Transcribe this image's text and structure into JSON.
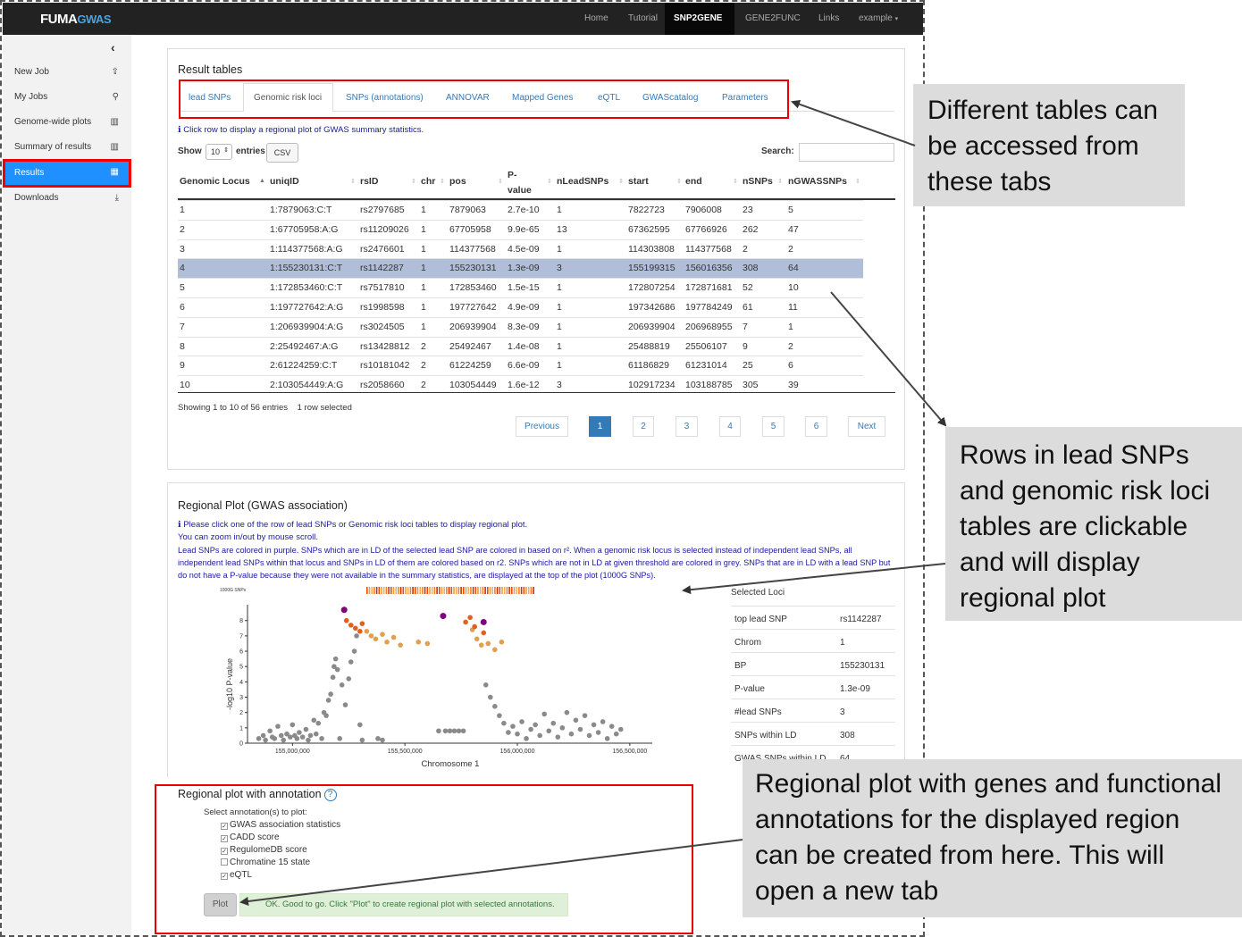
{
  "navbar": {
    "brand_main": "FUMA",
    "brand_sub": "GWAS",
    "items": [
      "Home",
      "Tutorial",
      "SNP2GENE",
      "GENE2FUNC",
      "Links",
      "example"
    ],
    "active": "SNP2GENE"
  },
  "sidebar": {
    "toggle": "‹",
    "items": [
      {
        "label": "New Job",
        "icon": "upload-icon"
      },
      {
        "label": "My Jobs",
        "icon": "search-icon"
      },
      {
        "label": "Genome-wide plots",
        "icon": "bar-chart-icon"
      },
      {
        "label": "Summary of results",
        "icon": "bar-chart-icon"
      },
      {
        "label": "Results",
        "icon": "table-icon"
      },
      {
        "label": "Downloads",
        "icon": "download-icon"
      }
    ]
  },
  "results": {
    "title": "Result tables",
    "tabs": [
      "lead SNPs",
      "Genomic risk loci",
      "SNPs (annotations)",
      "ANNOVAR",
      "Mapped Genes",
      "eQTL",
      "GWAScatalog",
      "Parameters"
    ],
    "info": "ℹ Click row to display a regional plot of GWAS summary statistics.",
    "show_label": "Show",
    "show_value": "10",
    "entries_label": "entries",
    "csv_label": "CSV",
    "search_label": "Search:",
    "columns": [
      "Genomic Locus",
      "uniqID",
      "rsID",
      "chr",
      "pos",
      "P-value",
      "nLeadSNPs",
      "start",
      "end",
      "nSNPs",
      "nGWASSNPs"
    ],
    "pvalue_line1": "P-",
    "pvalue_line2": "value",
    "rows": [
      [
        "1",
        "1:7879063:C:T",
        "rs2797685",
        "1",
        "7879063",
        "2.7e-10",
        "1",
        "7822723",
        "7906008",
        "23",
        "5"
      ],
      [
        "2",
        "1:67705958:A:G",
        "rs11209026",
        "1",
        "67705958",
        "9.9e-65",
        "13",
        "67362595",
        "67766926",
        "262",
        "47"
      ],
      [
        "3",
        "1:114377568:A:G",
        "rs2476601",
        "1",
        "114377568",
        "4.5e-09",
        "1",
        "114303808",
        "114377568",
        "2",
        "2"
      ],
      [
        "4",
        "1:155230131:C:T",
        "rs1142287",
        "1",
        "155230131",
        "1.3e-09",
        "3",
        "155199315",
        "156016356",
        "308",
        "64"
      ],
      [
        "5",
        "1:172853460:C:T",
        "rs7517810",
        "1",
        "172853460",
        "1.5e-15",
        "1",
        "172807254",
        "172871681",
        "52",
        "10"
      ],
      [
        "6",
        "1:197727642:A:G",
        "rs1998598",
        "1",
        "197727642",
        "4.9e-09",
        "1",
        "197342686",
        "197784249",
        "61",
        "11"
      ],
      [
        "7",
        "1:206939904:A:G",
        "rs3024505",
        "1",
        "206939904",
        "8.3e-09",
        "1",
        "206939904",
        "206968955",
        "7",
        "1"
      ],
      [
        "8",
        "2:25492467:A:G",
        "rs13428812",
        "2",
        "25492467",
        "1.4e-08",
        "1",
        "25488819",
        "25506107",
        "9",
        "2"
      ],
      [
        "9",
        "2:61224259:C:T",
        "rs10181042",
        "2",
        "61224259",
        "6.6e-09",
        "1",
        "61186829",
        "61231014",
        "25",
        "6"
      ],
      [
        "10",
        "2:103054449:A:G",
        "rs2058660",
        "2",
        "103054449",
        "1.6e-12",
        "3",
        "102917234",
        "103188785",
        "305",
        "39"
      ]
    ],
    "footer": "Showing 1 to 10 of 56 entries    1 row selected",
    "pagination": [
      "Previous",
      "1",
      "2",
      "3",
      "4",
      "5",
      "6",
      "Next"
    ]
  },
  "regional": {
    "title": "Regional Plot (GWAS association)",
    "info1": "ℹ Please click one of the row of lead SNPs or Genomic risk loci tables to display regional plot.",
    "info2": "You can zoom in/out by mouse scroll.",
    "info3": "Lead SNPs are colored in purple. SNPs which are in LD of the selected lead SNP are colored in based on r². When a genomic risk locus is selected instead of independent lead SNPs, all independent lead SNPs within that locus and SNPs in LD of them are colored based on r2. SNPs which are not in LD at given threshold are colored in grey. SNPs that are in LD with a lead SNP but do not have a P-value because they were not available in the summary statistics, are displayed at the top of the plot (1000G SNPs).",
    "plot_top_label": "1000G SNPs",
    "ylabel": "-log10 P-value",
    "xlabel": "Chromosome 1",
    "yticks": [
      "0",
      "1",
      "2",
      "3",
      "4",
      "5",
      "6",
      "7",
      "8"
    ],
    "xticks": [
      "155,000,000",
      "155,500,000",
      "156,000,000",
      "156,500,000"
    ],
    "selected_loci_title": "Selected Loci",
    "selected_loci": [
      {
        "key": "top lead SNP",
        "value": "rs1142287"
      },
      {
        "key": "Chrom",
        "value": "1"
      },
      {
        "key": "BP",
        "value": "155230131"
      },
      {
        "key": "P-value",
        "value": "1.3e-09"
      },
      {
        "key": "#lead SNPs",
        "value": "3"
      },
      {
        "key": "SNPs within LD",
        "value": "308"
      },
      {
        "key": "GWAS SNPs within LD",
        "value": "64"
      }
    ]
  },
  "annotation": {
    "title": "Regional plot with annotation",
    "help": "?",
    "select_label": "Select annotation(s) to plot:",
    "options": [
      {
        "label": "GWAS association statistics",
        "checked": true
      },
      {
        "label": "CADD score",
        "checked": true
      },
      {
        "label": "RegulomeDB score",
        "checked": true
      },
      {
        "label": "Chromatine 15 state",
        "checked": false
      },
      {
        "label": "eQTL",
        "checked": true
      }
    ],
    "plot_button": "Plot",
    "ok_message": "OK. Good to go. Click \"Plot\" to create regional plot with selected annotations."
  },
  "callouts": {
    "tabs": "Different tables can be accessed from these tabs",
    "rows": "Rows in lead SNPs and genomic risk loci tables are clickable and will display regional plot",
    "annotation": "Regional plot with genes and functional annotations for the displayed region can be created from here. This will open a new tab"
  },
  "chart_data": {
    "type": "scatter",
    "xlabel": "Chromosome 1",
    "ylabel": "-log10 P-value",
    "xlim": [
      154800000,
      156600000
    ],
    "ylim": [
      0,
      8.8
    ],
    "xticks": [
      155000000,
      155500000,
      156000000,
      156500000
    ],
    "yticks": [
      0,
      1,
      2,
      3,
      4,
      5,
      6,
      7,
      8
    ],
    "series": [
      {
        "color": "#8a8a8a",
        "points": [
          [
            154850000,
            0.3
          ],
          [
            154870000,
            0.5
          ],
          [
            154880000,
            0.2
          ],
          [
            154900000,
            0.8
          ],
          [
            154910000,
            0.4
          ],
          [
            154920000,
            0.3
          ],
          [
            154935000,
            1.1
          ],
          [
            154950000,
            0.5
          ],
          [
            154960000,
            0.2
          ],
          [
            154975000,
            0.6
          ],
          [
            154990000,
            0.4
          ],
          [
            155000000,
            1.2
          ],
          [
            155010000,
            0.5
          ],
          [
            155020000,
            0.3
          ],
          [
            155030000,
            0.7
          ],
          [
            155045000,
            0.4
          ],
          [
            155060000,
            0.9
          ],
          [
            155070000,
            0.2
          ],
          [
            155080000,
            0.5
          ],
          [
            155095000,
            1.5
          ],
          [
            155105000,
            0.6
          ],
          [
            155115000,
            1.3
          ],
          [
            155130000,
            0.3
          ],
          [
            155140000,
            2.0
          ],
          [
            155150000,
            1.8
          ],
          [
            155160000,
            2.8
          ],
          [
            155170000,
            3.2
          ],
          [
            155180000,
            4.3
          ],
          [
            155185000,
            5.0
          ],
          [
            155192000,
            5.5
          ],
          [
            155200000,
            4.8
          ],
          [
            155210000,
            0.3
          ],
          [
            155220000,
            3.8
          ],
          [
            155235000,
            2.5
          ],
          [
            155250000,
            4.2
          ],
          [
            155260000,
            5.3
          ],
          [
            155275000,
            6.0
          ],
          [
            155285000,
            7.0
          ],
          [
            155300000,
            1.2
          ],
          [
            155310000,
            0.2
          ],
          [
            155380000,
            0.3
          ],
          [
            155400000,
            0.2
          ],
          [
            155650000,
            0.8
          ],
          [
            155680000,
            0.8
          ],
          [
            155700000,
            0.8
          ],
          [
            155720000,
            0.8
          ],
          [
            155740000,
            0.8
          ],
          [
            155760000,
            0.8
          ],
          [
            155860000,
            3.8
          ],
          [
            155880000,
            3.0
          ],
          [
            155900000,
            2.4
          ],
          [
            155920000,
            1.8
          ],
          [
            155940000,
            1.3
          ],
          [
            155960000,
            0.7
          ],
          [
            155980000,
            1.1
          ],
          [
            156000000,
            0.6
          ],
          [
            156020000,
            1.4
          ],
          [
            156040000,
            0.3
          ],
          [
            156060000,
            0.9
          ],
          [
            156080000,
            1.2
          ],
          [
            156100000,
            0.5
          ],
          [
            156120000,
            1.9
          ],
          [
            156140000,
            0.8
          ],
          [
            156160000,
            1.3
          ],
          [
            156180000,
            0.4
          ],
          [
            156200000,
            1.0
          ],
          [
            156220000,
            2.0
          ],
          [
            156240000,
            0.6
          ],
          [
            156260000,
            1.5
          ],
          [
            156280000,
            0.9
          ],
          [
            156300000,
            1.8
          ],
          [
            156320000,
            0.5
          ],
          [
            156340000,
            1.2
          ],
          [
            156360000,
            0.7
          ],
          [
            156380000,
            1.4
          ],
          [
            156400000,
            0.3
          ],
          [
            156420000,
            1.1
          ],
          [
            156440000,
            0.6
          ],
          [
            156460000,
            0.9
          ]
        ]
      },
      {
        "color": "#e0a050",
        "points": [
          [
            155330000,
            7.3
          ],
          [
            155350000,
            7.0
          ],
          [
            155370000,
            6.8
          ],
          [
            155400000,
            7.1
          ],
          [
            155420000,
            6.6
          ],
          [
            155450000,
            6.9
          ],
          [
            155480000,
            6.4
          ],
          [
            155560000,
            6.6
          ],
          [
            155600000,
            6.5
          ],
          [
            155800000,
            7.4
          ],
          [
            155820000,
            6.8
          ],
          [
            155840000,
            6.4
          ],
          [
            155870000,
            6.5
          ],
          [
            155900000,
            6.1
          ],
          [
            155930000,
            6.6
          ]
        ]
      },
      {
        "color": "#e06020",
        "points": [
          [
            155240000,
            8.0
          ],
          [
            155260000,
            7.7
          ],
          [
            155280000,
            7.5
          ],
          [
            155300000,
            7.3
          ],
          [
            155310000,
            7.8
          ],
          [
            155770000,
            7.9
          ],
          [
            155790000,
            8.2
          ],
          [
            155810000,
            7.6
          ],
          [
            155850000,
            7.2
          ]
        ]
      },
      {
        "color": "#800080",
        "points": [
          [
            155230000,
            8.7
          ],
          [
            155670000,
            8.3
          ],
          [
            155850000,
            7.9
          ]
        ]
      }
    ]
  }
}
